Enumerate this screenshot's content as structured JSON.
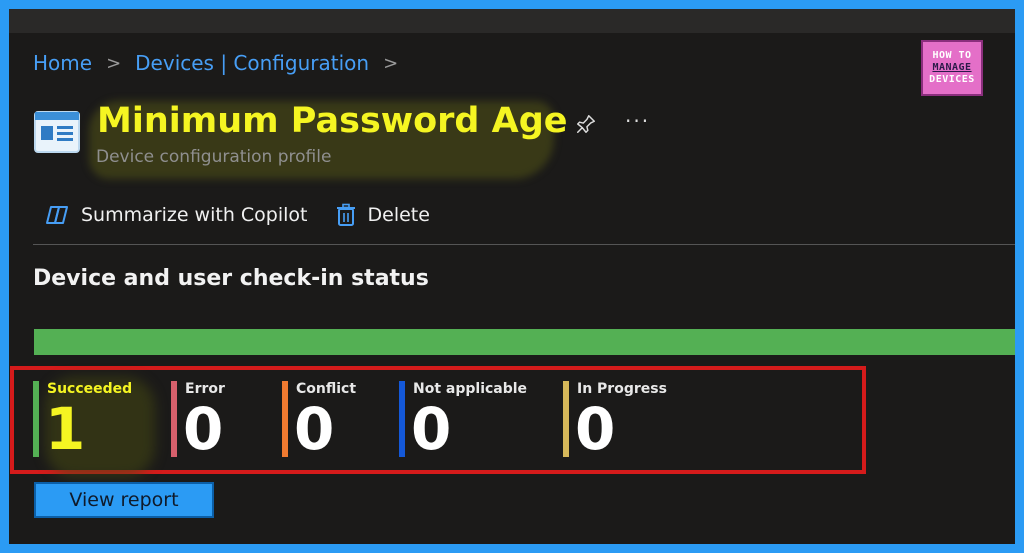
{
  "breadcrumb": {
    "home": "Home",
    "sep1": ">",
    "devices": "Devices | Configuration",
    "sep2": ">"
  },
  "logo": {
    "line1": "HOW TO",
    "line2": "MANAGE",
    "line3": "DEVICES"
  },
  "header": {
    "title": "Minimum Password Age",
    "subtitle": "Device configuration profile",
    "more": "···"
  },
  "toolbar": {
    "copilot_label": "Summarize with Copilot",
    "delete_label": "Delete"
  },
  "status": {
    "title": "Device and user check-in status",
    "succeeded_fraction": 1.0,
    "items": [
      {
        "label": "Succeeded",
        "value": "1",
        "color": "#54b054"
      },
      {
        "label": "Error",
        "value": "0",
        "color": "#d6606c"
      },
      {
        "label": "Conflict",
        "value": "0",
        "color": "#f07a30"
      },
      {
        "label": "Not applicable",
        "value": "0",
        "color": "#1458d8"
      },
      {
        "label": "In Progress",
        "value": "0",
        "color": "#d6b85a"
      }
    ]
  },
  "actions": {
    "view_report": "View report"
  },
  "colors": {
    "accent": "#2b9bf4",
    "title": "#f5f522",
    "highlight_border": "#d51b1b"
  }
}
